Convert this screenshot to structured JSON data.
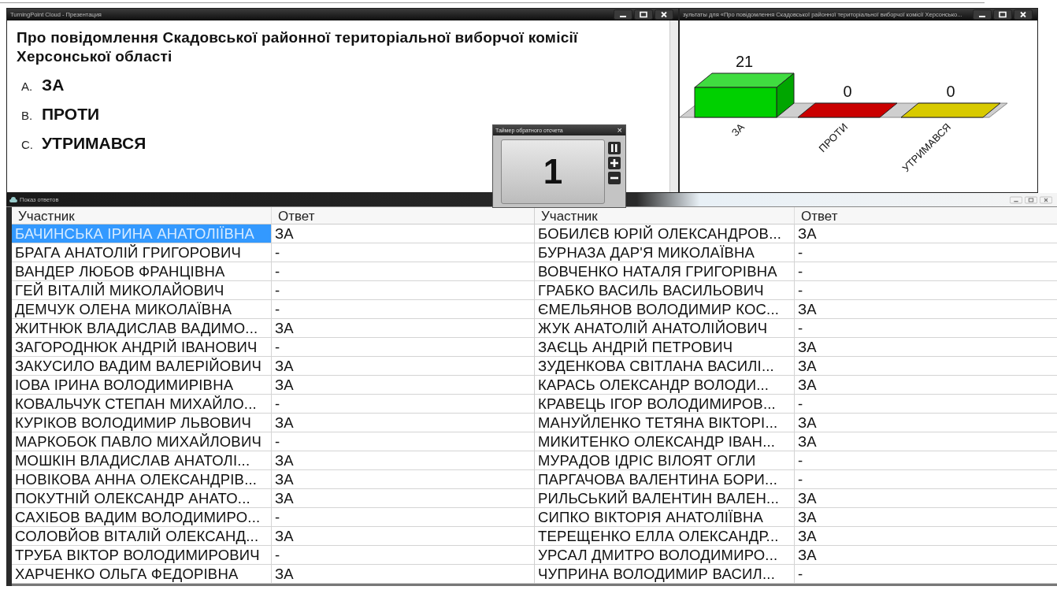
{
  "presentation_window": {
    "title": "TurningPoint Cloud - Презентация",
    "question": "Про повідомлення Скадовської районної територіальної виборчої комісії Херсонської області",
    "answers": [
      {
        "letter": "A.",
        "text": "ЗА"
      },
      {
        "letter": "B.",
        "text": "ПРОТИ"
      },
      {
        "letter": "C.",
        "text": "УТРИМАВСЯ"
      }
    ]
  },
  "results_window": {
    "title": "зультаты для «Про повідомлення Скадовської районної територіальної виборчої комісії Херсонсько...",
    "chart_data": {
      "type": "bar",
      "categories": [
        "ЗА",
        "ПРОТИ",
        "УТРИМАВСЯ"
      ],
      "values": [
        21,
        0,
        0
      ],
      "colors": [
        "#00d000",
        "#e00000",
        "#f0e000"
      ],
      "data_labels": true
    }
  },
  "responses_window": {
    "title": "Показ ответов",
    "tables": [
      {
        "columns": [
          "Участник",
          "Ответ"
        ],
        "rows": [
          {
            "participant": "БАЧИНСЬКА ІРИНА АНАТОЛІЇВНА",
            "answer": "ЗА",
            "selected": true
          },
          {
            "participant": "БРАГА АНАТОЛІЙ ГРИГОРОВИЧ",
            "answer": "-",
            "selected": false
          },
          {
            "participant": "ВАНДЕР ЛЮБОВ ФРАНЦІВНА",
            "answer": "-",
            "selected": false
          },
          {
            "participant": "ГЕЙ ВІТАЛІЙ МИКОЛАЙОВИЧ",
            "answer": "-",
            "selected": false
          },
          {
            "participant": "ДЕМЧУК ОЛЕНА МИКОЛАЇВНА",
            "answer": "-",
            "selected": false
          },
          {
            "participant": "ЖИТНЮК ВЛАДИСЛАВ ВАДИМО...",
            "answer": "ЗА",
            "selected": false
          },
          {
            "participant": "ЗАГОРОДНЮК АНДРІЙ ІВАНОВИЧ",
            "answer": "-",
            "selected": false
          },
          {
            "participant": "ЗАКУСИЛО ВАДИМ ВАЛЕРІЙОВИЧ",
            "answer": "ЗА",
            "selected": false
          },
          {
            "participant": "ІОВА ІРИНА ВОЛОДИМИРІВНА",
            "answer": "ЗА",
            "selected": false
          },
          {
            "participant": "КОВАЛЬЧУК СТЕПАН МИХАЙЛО...",
            "answer": "-",
            "selected": false
          },
          {
            "participant": "КУРІКОВ ВОЛОДИМИР ЛЬВОВИЧ",
            "answer": "ЗА",
            "selected": false
          },
          {
            "participant": "МАРКОБОК ПАВЛО МИХАЙЛОВИЧ",
            "answer": "-",
            "selected": false
          },
          {
            "participant": "МОШКІН ВЛАДИСЛАВ АНАТОЛІ...",
            "answer": "ЗА",
            "selected": false
          },
          {
            "participant": "НОВІКОВА АННА ОЛЕКСАНДРІВ...",
            "answer": "ЗА",
            "selected": false
          },
          {
            "participant": "ПОКУТНІЙ ОЛЕКСАНДР АНАТО...",
            "answer": "ЗА",
            "selected": false
          },
          {
            "participant": "САХІБОВ ВАДИМ ВОЛОДИМИРО...",
            "answer": "-",
            "selected": false
          },
          {
            "participant": "СОЛОВЙОВ ВІТАЛІЙ ОЛЕКСАНД...",
            "answer": "ЗА",
            "selected": false
          },
          {
            "participant": "ТРУБА ВІКТОР ВОЛОДИМИРОВИЧ",
            "answer": "-",
            "selected": false
          },
          {
            "participant": "ХАРЧЕНКО ОЛЬГА ФЕДОРІВНА",
            "answer": "ЗА",
            "selected": false
          }
        ]
      },
      {
        "columns": [
          "Участник",
          "Ответ"
        ],
        "rows": [
          {
            "participant": "БОБИЛЄВ ЮРІЙ ОЛЕКСАНДРОВ...",
            "answer": "ЗА",
            "selected": false
          },
          {
            "participant": "БУРНАЗА ДАР'Я МИКОЛАЇВНА",
            "answer": "-",
            "selected": false
          },
          {
            "participant": "ВОВЧЕНКО НАТАЛЯ ГРИГОРІВНА",
            "answer": "-",
            "selected": false
          },
          {
            "participant": "ГРАБКО ВАСИЛЬ ВАСИЛЬОВИЧ",
            "answer": "-",
            "selected": false
          },
          {
            "participant": "ЄМЕЛЬЯНОВ ВОЛОДИМИР КОС...",
            "answer": "ЗА",
            "selected": false
          },
          {
            "participant": "ЖУК АНАТОЛІЙ АНАТОЛІЙОВИЧ",
            "answer": "-",
            "selected": false
          },
          {
            "participant": "ЗАЄЦЬ АНДРІЙ ПЕТРОВИЧ",
            "answer": "ЗА",
            "selected": false
          },
          {
            "participant": "ЗУДЕНКОВА СВІТЛАНА ВАСИЛІ...",
            "answer": "ЗА",
            "selected": false
          },
          {
            "participant": "КАРАСЬ ОЛЕКСАНДР ВОЛОДИ...",
            "answer": "ЗА",
            "selected": false
          },
          {
            "participant": "КРАВЕЦЬ ІГОР ВОЛОДИМИРОВ...",
            "answer": "-",
            "selected": false
          },
          {
            "participant": "МАНУЙЛЕНКО ТЕТЯНА ВІКТОРІ...",
            "answer": "ЗА",
            "selected": false
          },
          {
            "participant": "МИКИТЕНКО ОЛЕКСАНДР ІВАН...",
            "answer": "ЗА",
            "selected": false
          },
          {
            "participant": "МУРАДОВ ІДРІС ВІЛОЯТ ОГЛИ",
            "answer": "-",
            "selected": false
          },
          {
            "participant": "ПАРГАЧОВА ВАЛЕНТИНА БОРИ...",
            "answer": "-",
            "selected": false
          },
          {
            "participant": "РИЛЬСЬКИЙ ВАЛЕНТИН ВАЛЕН...",
            "answer": "ЗА",
            "selected": false
          },
          {
            "participant": "СИПКО ВІКТОРІЯ АНАТОЛІЇВНА",
            "answer": "ЗА",
            "selected": false
          },
          {
            "participant": "ТЕРЕЩЕНКО ЕЛЛА ОЛЕКСАНДР...",
            "answer": "ЗА",
            "selected": false
          },
          {
            "participant": "УРСАЛ ДМИТРО ВОЛОДИМИРО...",
            "answer": "ЗА",
            "selected": false
          },
          {
            "participant": "ЧУПРИНА ВОЛОДИМИР ВАСИЛ...",
            "answer": "-",
            "selected": false
          }
        ]
      }
    ]
  },
  "timer": {
    "title": "Таймер обратного отсчета",
    "close": "×",
    "count": "1"
  }
}
